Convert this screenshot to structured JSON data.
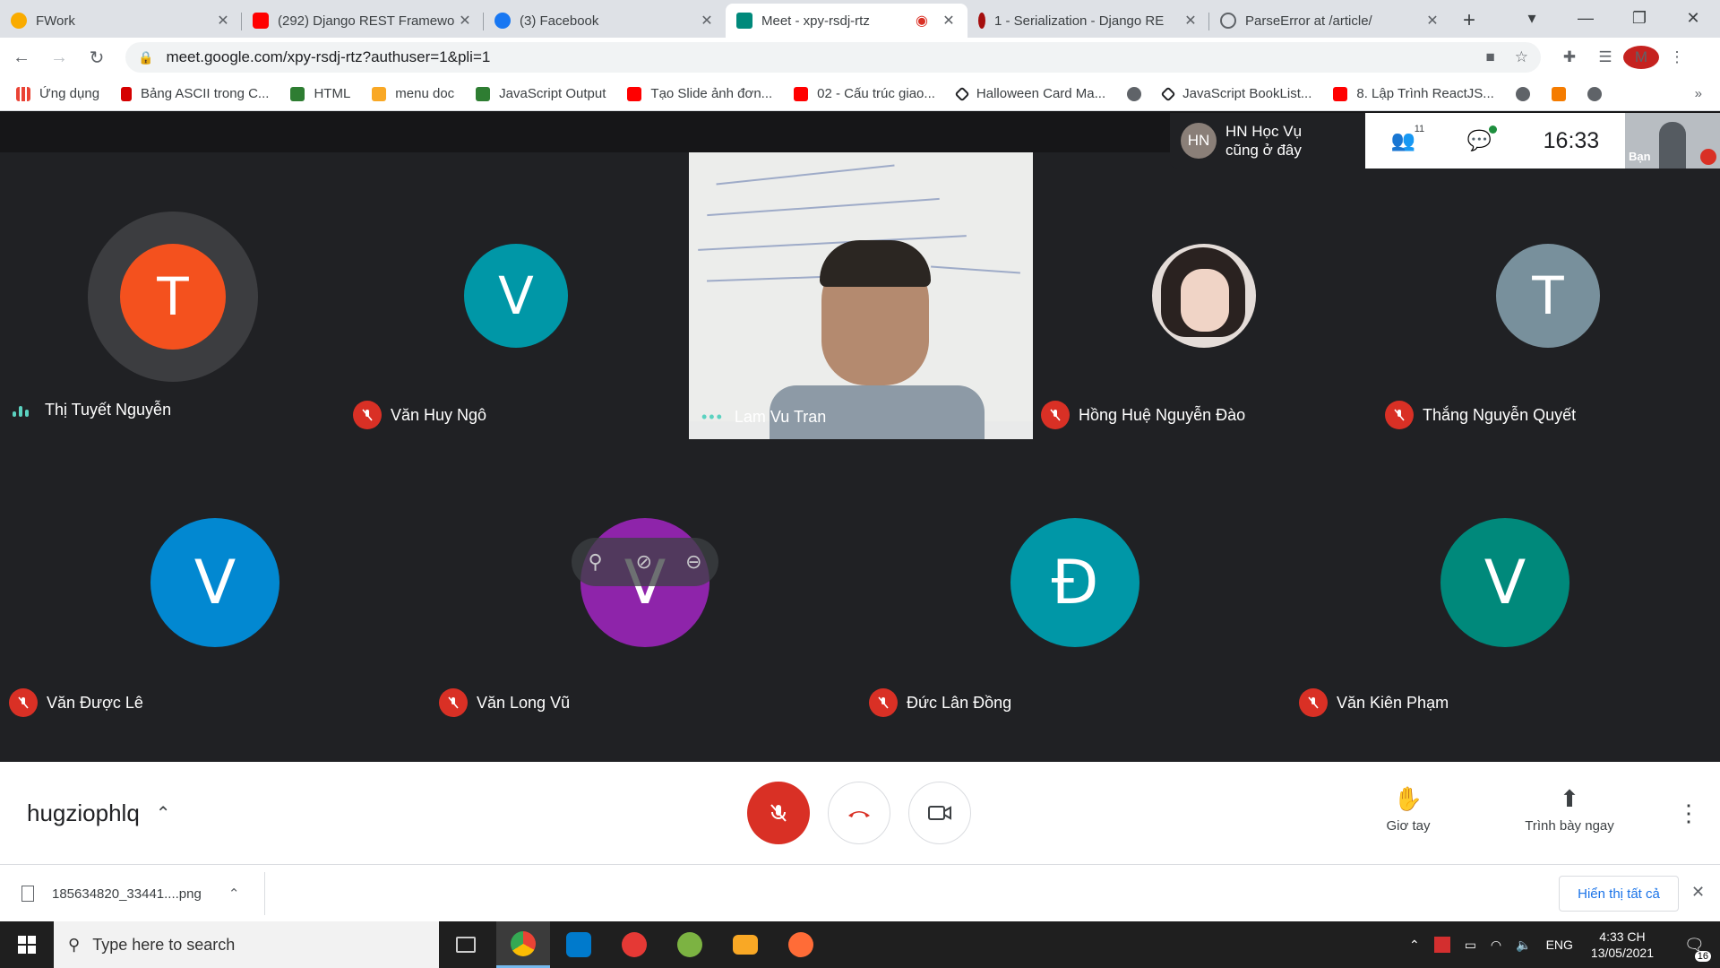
{
  "browser": {
    "tabs": [
      {
        "title": "FWork",
        "color": "#f9ab00"
      },
      {
        "title": "(292) Django REST Framewo",
        "color": "#ff0000"
      },
      {
        "title": "(3) Facebook",
        "color": "#1877f2"
      },
      {
        "title": "Meet - xpy-rsdj-rtz",
        "color": "#00897b",
        "active": true
      },
      {
        "title": "1 - Serialization - Django RE",
        "color": "#a50e0e"
      },
      {
        "title": "ParseError at /article/",
        "color": "#5f6368"
      }
    ],
    "new_tab": "+",
    "window_controls": {
      "menu": "▾",
      "minimize": "—",
      "maximize": "❐",
      "close": "✕"
    },
    "url": "meet.google.com/xpy-rsdj-rtz?authuser=1&pli=1",
    "profile_initial": "M",
    "bookmarks": [
      {
        "label": "Ứng dụng",
        "color": "#ea4335"
      },
      {
        "label": "Bảng ASCII trong C...",
        "color": "#d50000"
      },
      {
        "label": "HTML",
        "color": "#2e7d32"
      },
      {
        "label": "menu doc",
        "color": "#f9a825"
      },
      {
        "label": "JavaScript Output",
        "color": "#2e7d32"
      },
      {
        "label": "Tạo Slide ảnh đơn...",
        "color": "#ff0000"
      },
      {
        "label": "02 - Cấu trúc giao...",
        "color": "#ff0000"
      },
      {
        "label": "Halloween Card Ma...",
        "color": "#202124"
      },
      {
        "label": "",
        "color": "#5f6368"
      },
      {
        "label": "JavaScript BookList...",
        "color": "#202124"
      },
      {
        "label": "8. Lập Trình ReactJS...",
        "color": "#ff0000"
      },
      {
        "label": "",
        "color": "#5f6368"
      },
      {
        "label": "",
        "color": "#f57c00"
      },
      {
        "label": "",
        "color": "#5f6368"
      }
    ],
    "bookmarks_more": "»"
  },
  "meet": {
    "presenter_chip": {
      "initials": "HN",
      "line1": "HN Học Vụ",
      "line2": "cũng ở đây"
    },
    "participants_count": "11",
    "clock": "16:33",
    "self_label": "Bạn",
    "participants": [
      {
        "initial": "T",
        "name": "Thị Tuyết Nguyễn",
        "color": "#f4511e",
        "state": "speaking"
      },
      {
        "initial": "V",
        "name": "Văn Huy Ngô",
        "color": "#0097a7",
        "state": "muted"
      },
      {
        "initial": "",
        "name": "Lam Vu Tran",
        "color": "",
        "state": "video"
      },
      {
        "initial": "",
        "name": "Hồng Huệ Nguyễn Đào",
        "color": "",
        "state": "muted"
      },
      {
        "initial": "T",
        "name": "Thắng Nguyễn Quyết",
        "color": "#78909c",
        "state": "muted"
      },
      {
        "initial": "V",
        "name": "Văn Được Lê",
        "color": "#0288d1",
        "state": "muted"
      },
      {
        "initial": "V",
        "name": "Văn Long Vũ",
        "color": "#8e24aa",
        "state": "muted"
      },
      {
        "initial": "Đ",
        "name": "Đức Lân Đồng",
        "color": "#0097a7",
        "state": "muted"
      },
      {
        "initial": "V",
        "name": "Văn Kiên Phạm",
        "color": "#00897b",
        "state": "muted"
      }
    ],
    "meeting_code": "hugziophlq",
    "raise_hand": "Giơ tay",
    "present_now": "Trình bày ngay"
  },
  "downloads": {
    "file": "185634820_33441....png",
    "show_all": "Hiển thị tất cả"
  },
  "taskbar": {
    "search_placeholder": "Type here to search",
    "language": "ENG",
    "time": "4:33 CH",
    "date": "13/05/2021",
    "notifications": "16",
    "apps": [
      {
        "name": "task-view",
        "color": "#5f6368"
      },
      {
        "name": "chrome",
        "color": "#34a853",
        "active": true
      },
      {
        "name": "vscode",
        "color": "#007acc"
      },
      {
        "name": "garena",
        "color": "#e53935"
      },
      {
        "name": "coccoc",
        "color": "#7cb342"
      },
      {
        "name": "file-explorer",
        "color": "#f9a825"
      },
      {
        "name": "postman",
        "color": "#ff6c37"
      }
    ]
  }
}
